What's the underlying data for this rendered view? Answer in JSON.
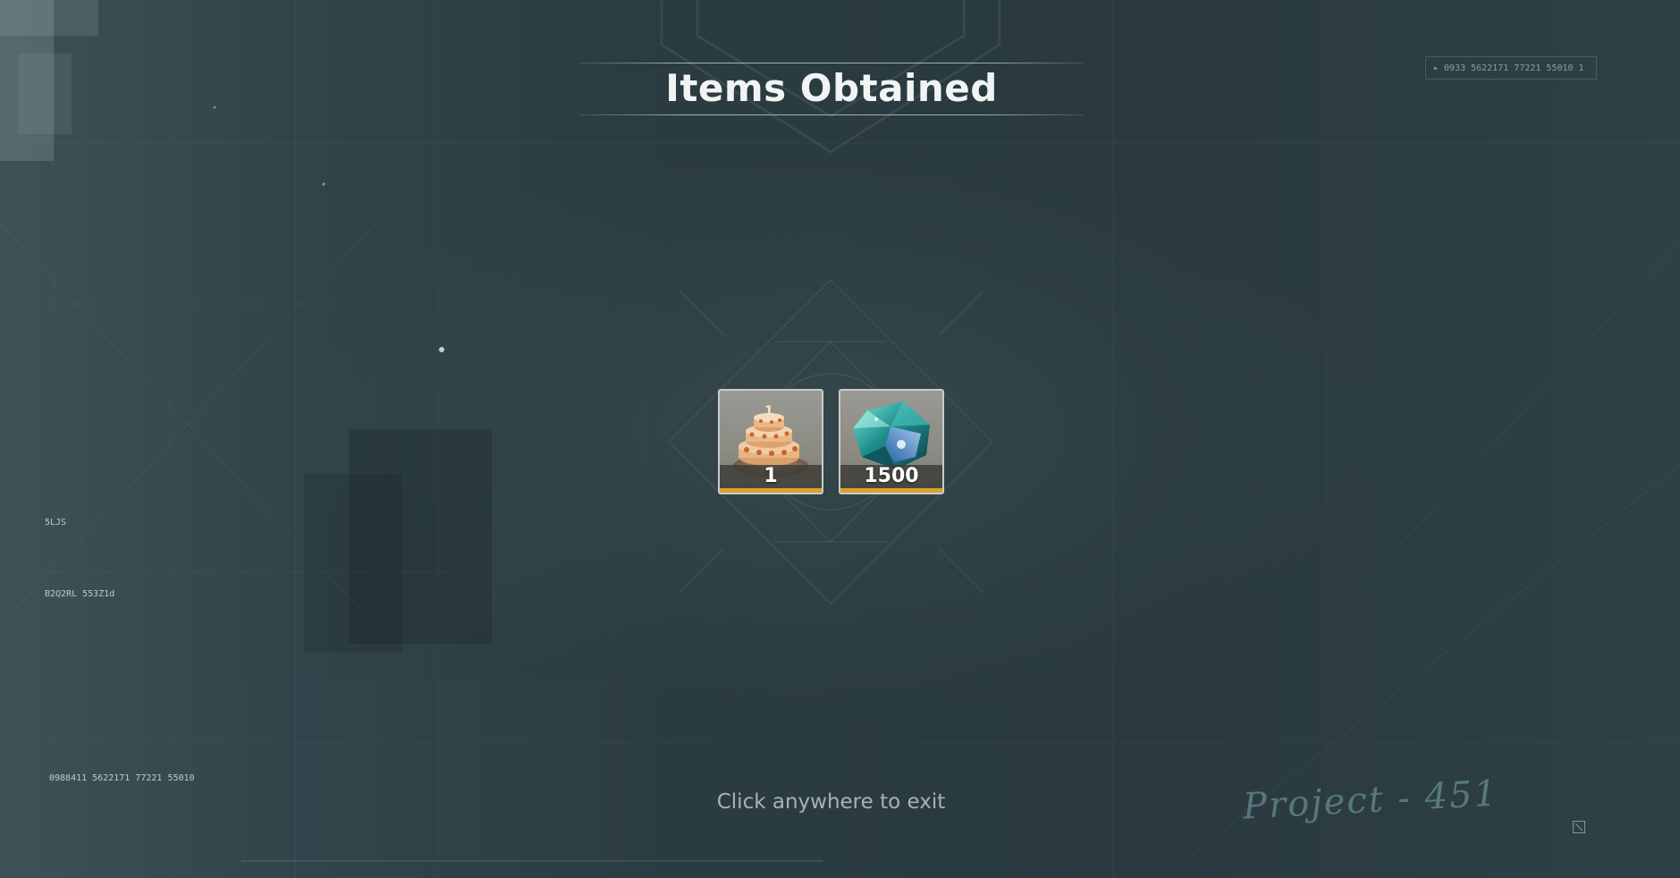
{
  "header": {
    "title": "Items Obtained"
  },
  "rewards": {
    "items": [
      {
        "name": "birthday-cake",
        "icon": "cake-icon",
        "quantity": "1",
        "rarity_color": "#d9a22a"
      },
      {
        "name": "blue-crystal",
        "icon": "crystal-icon",
        "quantity": "1500",
        "rarity_color": "#d9a22a"
      }
    ]
  },
  "footer": {
    "hint": "Click anywhere to exit"
  },
  "hud": {
    "top_right_code": "▸  0933  5622171  77221  55010  1",
    "left_panel": {
      "code_a": "5LJS",
      "code_b": "B2Q2RL  553Z1d",
      "code_c": "0988411  5622171  77221  55010"
    },
    "signature": "Project - 451"
  },
  "colors": {
    "accent": "#d9a22a",
    "background": "#2a3a3f",
    "title": "#f2f4f4",
    "hint": "#a8b2b3"
  }
}
